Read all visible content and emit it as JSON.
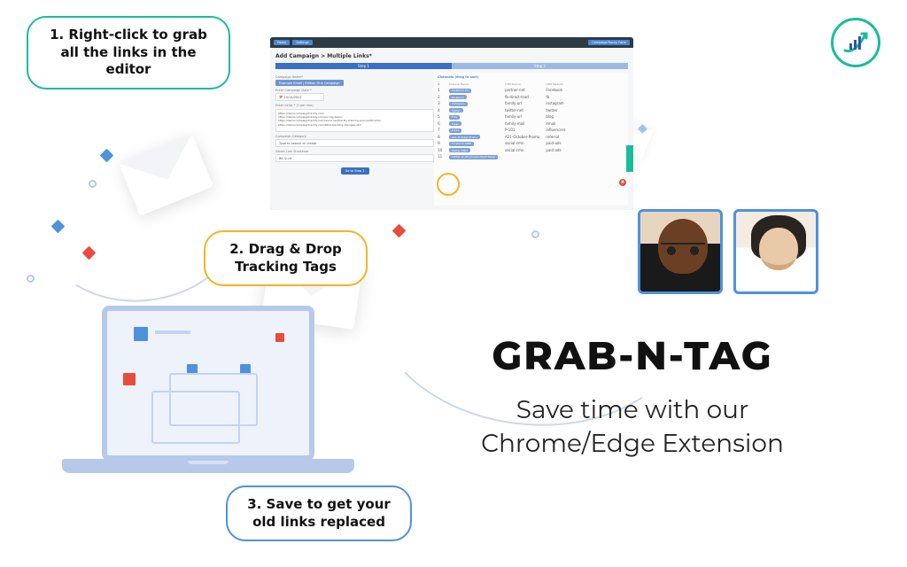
{
  "bubbles": {
    "b1": "1. Right-click to grab all the links in the editor",
    "b2": "2. Drag & Drop Tracking Tags",
    "b3": "3. Save to get your old links replaced"
  },
  "panel": {
    "top_left": [
      "Home",
      "Settings"
    ],
    "top_right": "CampaignTracky Form",
    "title": "Add Campaign > Multiple Links*",
    "step1": "Step 1",
    "step2": "Step 2",
    "campaign_name_label": "Campaign Name*",
    "campaign_name_value": "Example Email | Edition One Campaign",
    "date_label": "Enter Campaign Date *",
    "date_value": "10/14/2022",
    "urls_label": "Enter Links * (1 per line)",
    "urls": "https://democampaigntrackly.com/\nhttps://democampaigntrackly.com/pricing-plans/\nhttps://democampaigntrackly.com/resources/trackly-training-and-certification\nhttps://democampaigntrackly.com/2019-tracking-changes-utm",
    "category_label": "Campaign Category",
    "category_value": "Type to search or create",
    "shortener_label": "Select Link Shortener",
    "shortener_value": "Bit.ly-ctr",
    "go_btn": "Go to Step 2",
    "right_header": "Channels (drag to sort)",
    "cols": [
      "#",
      "Channel Name",
      "UTM Source",
      "UTM Medium"
    ],
    "rows": [
      {
        "n": "1",
        "ch": "Facebook Ad",
        "src": "partner-net",
        "med": "Facebook"
      },
      {
        "n": "2",
        "ch": "Facebook",
        "src": "fb-direct-lead",
        "med": "fb"
      },
      {
        "n": "3",
        "ch": "Instagram",
        "src": "family-url",
        "med": "instagram"
      },
      {
        "n": "4",
        "ch": "Twitter",
        "src": "twitter-net",
        "med": "twitter"
      },
      {
        "n": "5",
        "ch": "Blog",
        "src": "family-url",
        "med": "blog"
      },
      {
        "n": "6",
        "ch": "Email",
        "src": "family-mail",
        "med": "email"
      },
      {
        "n": "7",
        "ch": "P-101",
        "src": "P-101",
        "med": "influencers"
      },
      {
        "n": "8",
        "ch": "A21-October-Promo",
        "src": "A21-October-Promo",
        "med": "referral"
      },
      {
        "n": "9",
        "ch": "Facebook-SMM",
        "src": "social-cmn",
        "med": "paid-ads"
      },
      {
        "n": "10",
        "ch": "Twitter-SMM",
        "src": "social-cmn",
        "med": "paid-ads"
      },
      {
        "n": "11",
        "ch": "Twitter-an-Employee-Might-Tweet",
        "src": "",
        "med": ""
      }
    ]
  },
  "main": {
    "title": "GRAB-N-TAG",
    "subtitle_l1": "Save time with our",
    "subtitle_l2": "Chrome/Edge Extension"
  }
}
